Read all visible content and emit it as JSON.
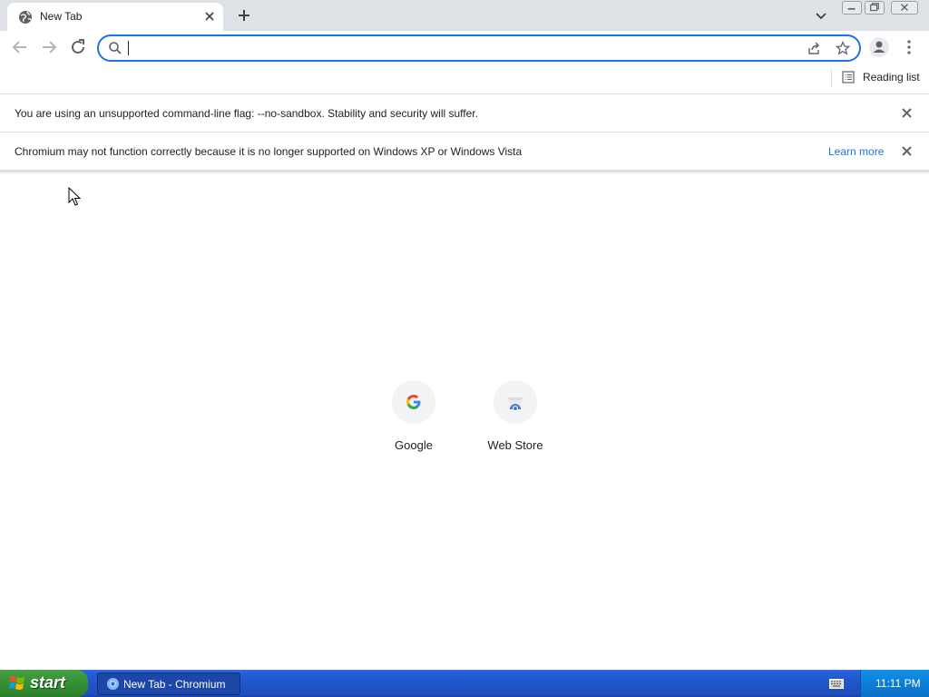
{
  "browser": {
    "tab": {
      "title": "New Tab",
      "close_icon": "close-icon",
      "favicon": "globe-icon"
    },
    "new_tab_icon": "plus-icon",
    "tab_search_icon": "chevron-down-icon",
    "window_controls": [
      "minimize-icon",
      "restore-icon",
      "close-icon"
    ],
    "toolbar": {
      "back_icon": "arrow-left-icon",
      "forward_icon": "arrow-right-icon",
      "reload_icon": "reload-icon",
      "omnibox": {
        "value": "",
        "search_icon": "search-icon",
        "share_icon": "share-icon",
        "bookmark_icon": "star-icon"
      },
      "profile_icon": "person-icon",
      "menu_icon": "more-vert-icon"
    },
    "bookmarks_bar": {
      "reading_list_label": "Reading list"
    }
  },
  "infobars": [
    {
      "message": "You are using an unsupported command-line flag: --no-sandbox. Stability and security will suffer."
    },
    {
      "message": "Chromium may not function correctly because it is no longer supported on Windows XP or Windows Vista",
      "link": "Learn more"
    }
  ],
  "shortcuts": [
    {
      "label": "Google",
      "icon": "google-icon"
    },
    {
      "label": "Web Store",
      "icon": "web-store-icon"
    }
  ],
  "taskbar": {
    "start_label": "start",
    "task_label": "New Tab - Chromium",
    "clock": "11:11 PM"
  },
  "colors": {
    "accent": "#1a73e8",
    "tabstrip": "#dee1e6",
    "taskbar": "#245edb",
    "start": "#379437"
  }
}
